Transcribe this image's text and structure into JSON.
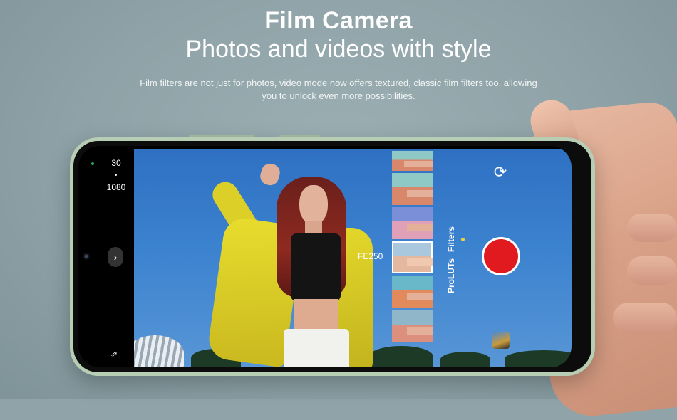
{
  "header": {
    "title": "Film Camera",
    "subtitle": "Photos and videos with style",
    "description": "Film filters are not just for photos, video mode now offers textured, classic film filters too, allowing you to unlock even more possibilities."
  },
  "camera": {
    "frame_rate": "30",
    "resolution": "1080",
    "selected_filter": "FE250",
    "tabs": [
      "Filters",
      "ProLUTs"
    ],
    "icons": {
      "flip": "flip-camera-icon",
      "expand": "chevron-right-icon",
      "flash": "flash-off-icon",
      "gallery": "gallery-thumbnail"
    },
    "colors": {
      "shutter": "#e11a1f",
      "active_tab_dot": "#f1d23d"
    }
  }
}
